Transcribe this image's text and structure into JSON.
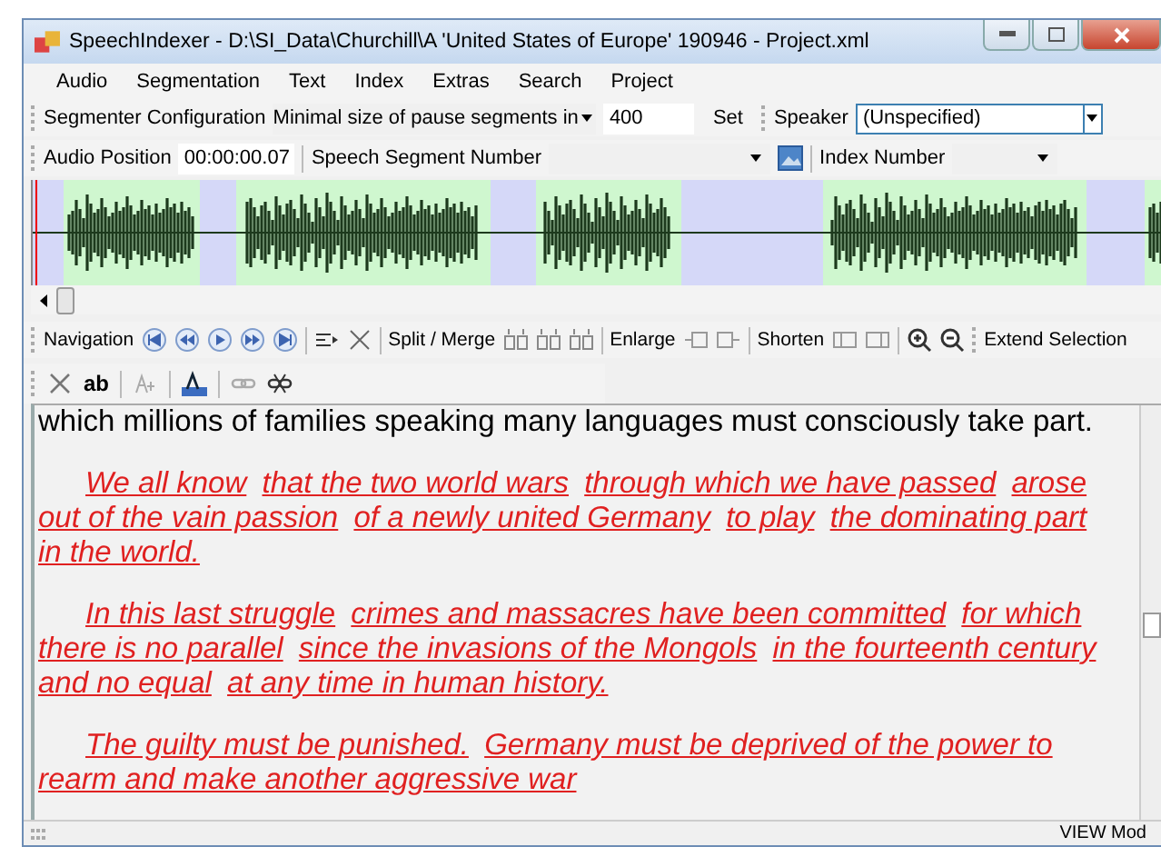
{
  "window": {
    "title": "SpeechIndexer - D:\\SI_Data\\Churchill\\A 'United States of Europe' 190946 - Project.xml"
  },
  "menu": [
    "Audio",
    "Segmentation",
    "Text",
    "Index",
    "Extras",
    "Search",
    "Project"
  ],
  "segmenter_toolbar": {
    "label": "Segmenter Configuration",
    "option": "Minimal size of pause segments in",
    "value": "400",
    "button": "Set",
    "speaker_label": "Speaker",
    "speaker": "(Unspecified)"
  },
  "position_toolbar": {
    "label": "Audio Position",
    "position": "00:00:00.07",
    "segment_number": "Speech Segment Number",
    "index_number": "Index Number"
  },
  "navigation_toolbar": {
    "navigation": "Navigation",
    "split_merge": "Split / Merge",
    "enlarge": "Enlarge",
    "shorten": "Shorten",
    "extend": "Extend Selection"
  },
  "text_toolbar": {
    "edit": "ab"
  },
  "paragraphs": [
    {
      "kind": "plain",
      "text": "which millions of families speaking many languages must consciously take part."
    },
    {
      "kind": "segmented",
      "segments": [
        "We all know",
        "that the two world wars",
        "through which we have passed",
        "arose out of the vain passion",
        "of a newly united Germany",
        "to play",
        "the dominating part in the world."
      ]
    },
    {
      "kind": "segmented",
      "segments": [
        "In this last struggle",
        "crimes and massacres have been committed",
        "for which there is no parallel",
        "since the invasions of the Mongols",
        "in the fourteenth century",
        "and no equal",
        "at any time in human history."
      ]
    },
    {
      "kind": "segmented",
      "segments": [
        "The guilty must be punished.",
        "Germany must be deprived of the power to rearm and make another aggressive war"
      ]
    }
  ],
  "status_bar": {
    "mode": "VIEW Mod"
  }
}
